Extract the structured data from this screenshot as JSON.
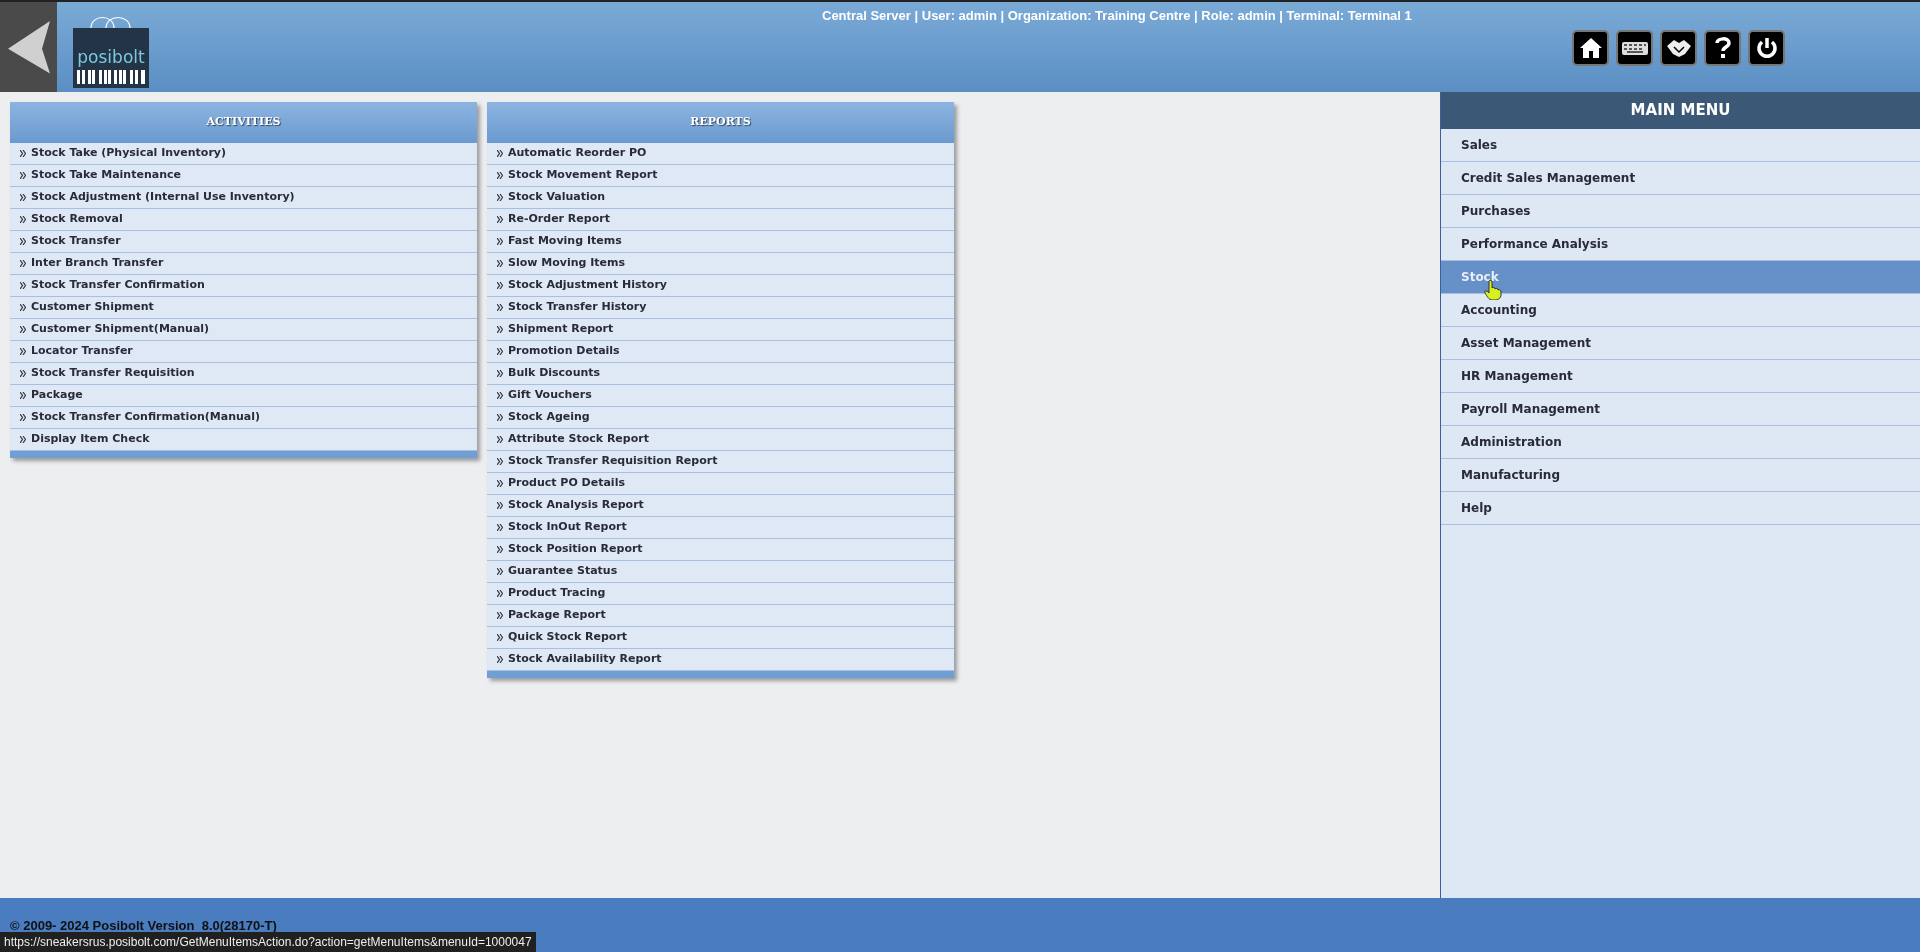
{
  "header": {
    "logo_text": "posibolt",
    "session_info": "Central Server | User: admin | Organization: Training Centre | Role: admin | Terminal: Terminal 1"
  },
  "panels": [
    {
      "title": "ACTIVITIES",
      "items": [
        "Stock Take (Physical Inventory)",
        "Stock Take Maintenance",
        "Stock Adjustment (Internal Use Inventory)",
        "Stock Removal",
        "Stock Transfer",
        "Inter Branch Transfer",
        "Stock Transfer Confirmation",
        "Customer Shipment",
        "Customer Shipment(Manual)",
        "Locator Transfer",
        "Stock Transfer Requisition",
        "Package",
        "Stock Transfer Confirmation(Manual)",
        "Display Item Check"
      ]
    },
    {
      "title": "REPORTS",
      "items": [
        "Automatic Reorder PO",
        "Stock Movement Report",
        "Stock Valuation",
        "Re-Order Report",
        "Fast Moving Items",
        "Slow Moving Items",
        "Stock Adjustment History",
        "Stock Transfer History",
        "Shipment Report",
        "Promotion Details",
        "Bulk Discounts",
        "Gift Vouchers",
        "Stock Ageing",
        "Attribute Stock Report",
        "Stock Transfer Requisition Report",
        "Product PO Details",
        "Stock Analysis Report",
        "Stock InOut Report",
        "Stock Position Report",
        "Guarantee Status",
        "Product Tracing",
        "Package Report",
        "Quick Stock Report",
        "Stock Availability Report"
      ]
    }
  ],
  "main_menu": {
    "title": "MAIN MENU",
    "items": [
      {
        "label": "Sales",
        "selected": false
      },
      {
        "label": "Credit Sales Management",
        "selected": false
      },
      {
        "label": "Purchases",
        "selected": false
      },
      {
        "label": "Performance Analysis",
        "selected": false
      },
      {
        "label": "Stock",
        "selected": true
      },
      {
        "label": "Accounting",
        "selected": false
      },
      {
        "label": "Asset Management",
        "selected": false
      },
      {
        "label": "HR Management",
        "selected": false
      },
      {
        "label": "Payroll Management",
        "selected": false
      },
      {
        "label": "Administration",
        "selected": false
      },
      {
        "label": "Manufacturing",
        "selected": false
      },
      {
        "label": "Help",
        "selected": false
      }
    ]
  },
  "footer": {
    "copyright": "© 2009- 2024 Posibolt Version  8.0(28170-T)"
  },
  "status_url": "https://sneakersrus.posibolt.com/GetMenuItemsAction.do?action=getMenuItems&menuId=1000047"
}
